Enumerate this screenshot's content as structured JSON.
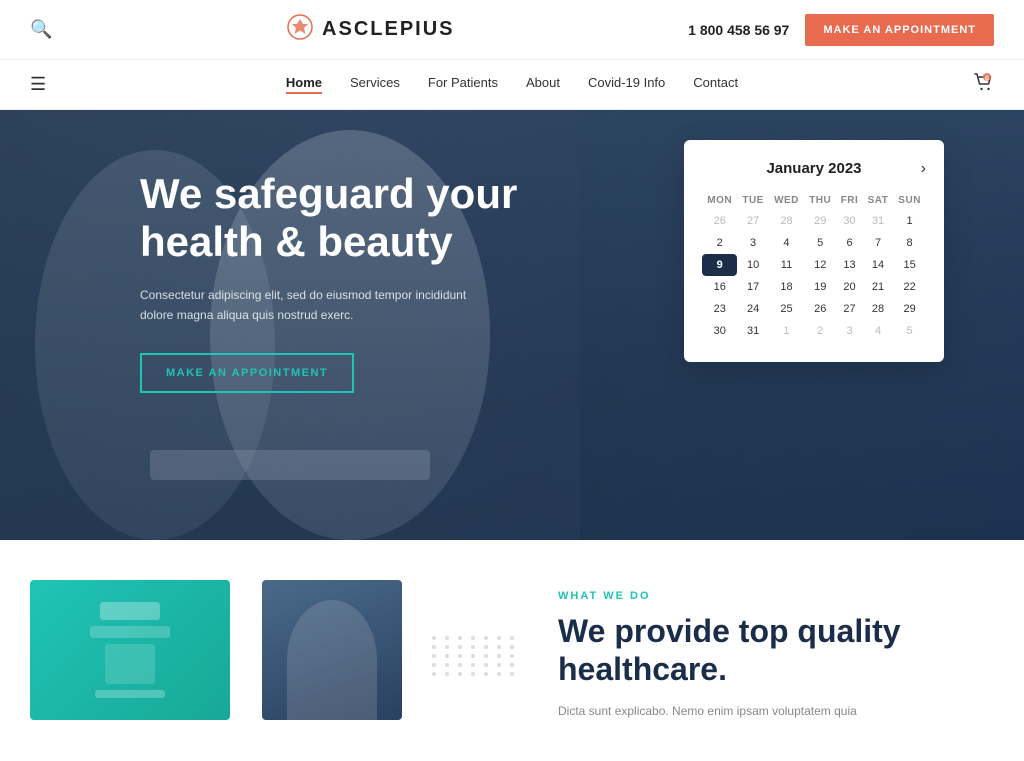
{
  "header": {
    "search_icon": "🔍",
    "logo_icon": "✦",
    "logo_text": "ASCLEPIUS",
    "phone": "1 800 458 56 97",
    "appointment_btn": "MAKE AN APPOINTMENT",
    "cart_icon": "🛒"
  },
  "nav": {
    "hamburger_icon": "☰",
    "links": [
      {
        "label": "Home",
        "active": true
      },
      {
        "label": "Services",
        "active": false
      },
      {
        "label": "For Patients",
        "active": false
      },
      {
        "label": "About",
        "active": false
      },
      {
        "label": "Covid-19 Info",
        "active": false
      },
      {
        "label": "Contact",
        "active": false
      }
    ]
  },
  "hero": {
    "title": "We safeguard your health & beauty",
    "description": "Consectetur adipiscing elit, sed do eiusmod tempor incididunt dolore magna aliqua quis nostrud exerc.",
    "cta_label": "MAKE AN APPOINTMENT"
  },
  "calendar": {
    "title": "January 2023",
    "nav_icon": "›",
    "days_header": [
      "MON",
      "TUE",
      "WED",
      "THU",
      "FRI",
      "SAT",
      "SUN"
    ],
    "weeks": [
      [
        {
          "d": "26",
          "o": true
        },
        {
          "d": "27",
          "o": true
        },
        {
          "d": "28",
          "o": true
        },
        {
          "d": "29",
          "o": true
        },
        {
          "d": "30",
          "o": true
        },
        {
          "d": "31",
          "o": true
        },
        {
          "d": "1",
          "o": false
        }
      ],
      [
        {
          "d": "2",
          "o": false
        },
        {
          "d": "3",
          "o": false
        },
        {
          "d": "4",
          "o": false
        },
        {
          "d": "5",
          "o": false
        },
        {
          "d": "6",
          "o": false
        },
        {
          "d": "7",
          "o": false
        },
        {
          "d": "8",
          "o": false
        }
      ],
      [
        {
          "d": "9",
          "o": false,
          "today": true
        },
        {
          "d": "10",
          "o": false
        },
        {
          "d": "11",
          "o": false
        },
        {
          "d": "12",
          "o": false
        },
        {
          "d": "13",
          "o": false
        },
        {
          "d": "14",
          "o": false
        },
        {
          "d": "15",
          "o": false
        }
      ],
      [
        {
          "d": "16",
          "o": false
        },
        {
          "d": "17",
          "o": false
        },
        {
          "d": "18",
          "o": false
        },
        {
          "d": "19",
          "o": false
        },
        {
          "d": "20",
          "o": false
        },
        {
          "d": "21",
          "o": false
        },
        {
          "d": "22",
          "o": false
        }
      ],
      [
        {
          "d": "23",
          "o": false
        },
        {
          "d": "24",
          "o": false
        },
        {
          "d": "25",
          "o": false
        },
        {
          "d": "26",
          "o": false
        },
        {
          "d": "27",
          "o": false
        },
        {
          "d": "28",
          "o": false
        },
        {
          "d": "29",
          "o": false
        }
      ],
      [
        {
          "d": "30",
          "o": false
        },
        {
          "d": "31",
          "o": false
        },
        {
          "d": "1",
          "o": true
        },
        {
          "d": "2",
          "o": true
        },
        {
          "d": "3",
          "o": true
        },
        {
          "d": "4",
          "o": true
        },
        {
          "d": "5",
          "o": true
        }
      ]
    ]
  },
  "bottom": {
    "what_we_do_label": "WHAT WE DO",
    "provide_title": "We provide top quality healthcare.",
    "provide_desc": "Dicta sunt explicabo. Nemo enim ipsam voluptatem quia"
  }
}
